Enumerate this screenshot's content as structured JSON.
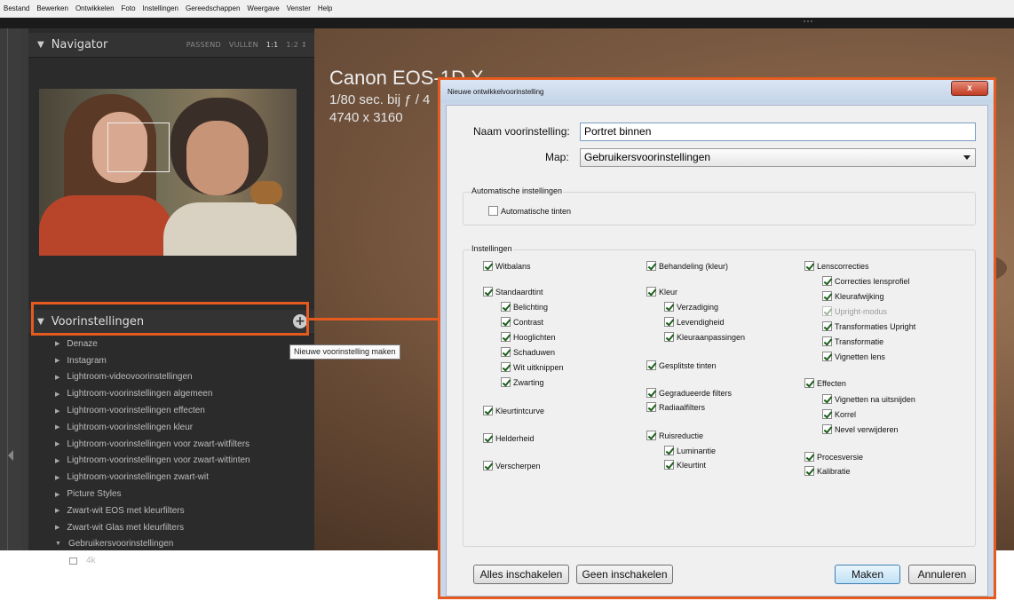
{
  "menu": [
    "Bestand",
    "Bewerken",
    "Ontwikkelen",
    "Foto",
    "Instellingen",
    "Gereedschappen",
    "Weergave",
    "Venster",
    "Help"
  ],
  "navigator": {
    "title": "Navigator",
    "options": [
      "PASSEND",
      "VULLEN",
      "1:1",
      "1:2 ↕"
    ]
  },
  "presets": {
    "title": "Voorinstellingen",
    "add_tooltip": "Nieuwe voorinstelling maken",
    "items": [
      "Denaze",
      "Instagram",
      "Lightroom-videovoorinstellingen",
      "Lightroom-voorinstellingen algemeen",
      "Lightroom-voorinstellingen effecten",
      "Lightroom-voorinstellingen kleur",
      "Lightroom-voorinstellingen voor zwart-witfilters",
      "Lightroom-voorinstellingen voor zwart-wittinten",
      "Lightroom-voorinstellingen zwart-wit",
      "Picture Styles",
      "Zwart-wit EOS met kleurfilters",
      "Zwart-wit Glas met kleurfilters",
      "Gebruikersvoorinstellingen"
    ],
    "sub_item": "4k"
  },
  "photo_info": {
    "camera": "Canon EOS-1D X",
    "exposure": "1/80 sec. bij ƒ / 4",
    "dimensions": "4740 x 3160"
  },
  "dialog": {
    "title": "Nieuwe ontwikkelvoorinstelling",
    "close_label": "x",
    "name_label": "Naam voorinstelling:",
    "name_value": "Portret binnen",
    "folder_label": "Map:",
    "folder_value": "Gebruikersvoorinstellingen",
    "auto_group": "Automatische instellingen",
    "auto_tone": "Automatische tinten",
    "settings_group": "Instellingen",
    "col1": {
      "witbalans": "Witbalans",
      "standaardtint": "Standaardtint",
      "belichting": "Belichting",
      "contrast": "Contrast",
      "hooglichten": "Hooglichten",
      "schaduwen": "Schaduwen",
      "wit_uitknippen": "Wit uitknippen",
      "zwarting": "Zwarting",
      "kleurtintcurve": "Kleurtintcurve",
      "helderheid": "Helderheid",
      "verscherpen": "Verscherpen"
    },
    "col2": {
      "behandeling": "Behandeling (kleur)",
      "kleur": "Kleur",
      "verzadiging": "Verzadiging",
      "levendigheid": "Levendigheid",
      "kleuraanpassingen": "Kleuraanpassingen",
      "gesplitste_tinten": "Gesplitste tinten",
      "gegradueerde_filters": "Gegradueerde filters",
      "radiaalfilters": "Radiaalfilters",
      "ruisreductie": "Ruisreductie",
      "luminantie": "Luminantie",
      "kleurtint": "Kleurtint"
    },
    "col3": {
      "lenscorrecties": "Lenscorrecties",
      "correcties_lensprofiel": "Correcties lensprofiel",
      "kleurafwijking": "Kleurafwijking",
      "upright_modus": "Upright-modus",
      "transformaties_upright": "Transformaties Upright",
      "transformatie": "Transformatie",
      "vignetten_lens": "Vignetten lens",
      "effecten": "Effecten",
      "vignetten_na_uitsnijden": "Vignetten na uitsnijden",
      "korrel": "Korrel",
      "nevel_verwijderen": "Nevel verwijderen",
      "procesversie": "Procesversie",
      "kalibratie": "Kalibratie"
    },
    "buttons": {
      "check_all": "Alles inschakelen",
      "check_none": "Geen inschakelen",
      "create": "Maken",
      "cancel": "Annuleren"
    }
  },
  "colors": {
    "highlight": "#e55a1f",
    "panel_bg": "#2b2b2b",
    "dialog_frame": "#c9d7e8"
  }
}
